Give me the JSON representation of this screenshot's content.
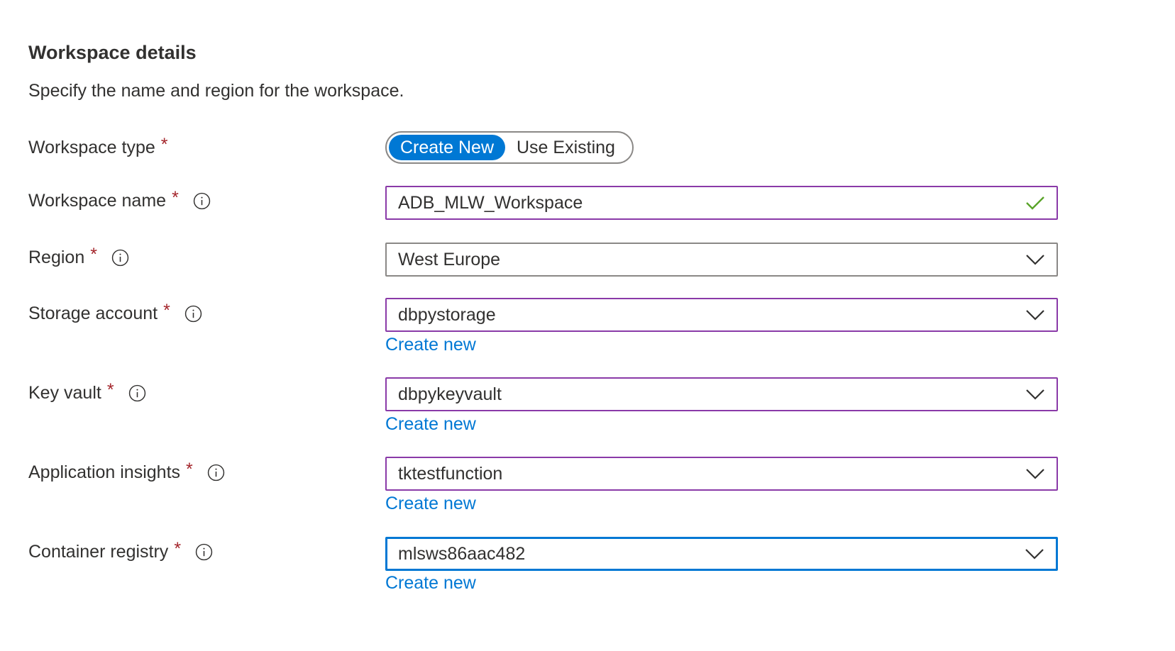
{
  "section": {
    "title": "Workspace details",
    "description": "Specify the name and region for the workspace."
  },
  "colors": {
    "accent": "#0078d4",
    "required": "#a4262c",
    "valid_check": "#5aa42a",
    "hover_border": "#8a3aa8"
  },
  "workspace_type": {
    "label": "Workspace type",
    "required_mark": "*",
    "options": [
      "Create New",
      "Use Existing"
    ],
    "selected": "Create New"
  },
  "workspace_name": {
    "label": "Workspace name",
    "required_mark": "*",
    "value": "ADB_MLW_Workspace",
    "icon": "checkmark-icon"
  },
  "region": {
    "label": "Region",
    "required_mark": "*",
    "value": "West Europe"
  },
  "storage_account": {
    "label": "Storage account",
    "required_mark": "*",
    "value": "dbpystorage",
    "create_link": "Create new"
  },
  "key_vault": {
    "label": "Key vault",
    "required_mark": "*",
    "value": "dbpykeyvault",
    "create_link": "Create new"
  },
  "app_insights": {
    "label": "Application insights",
    "required_mark": "*",
    "value": "tktestfunction",
    "create_link": "Create new"
  },
  "container_registry": {
    "label": "Container registry",
    "required_mark": "*",
    "value": "mlsws86aac482",
    "create_link": "Create new"
  }
}
